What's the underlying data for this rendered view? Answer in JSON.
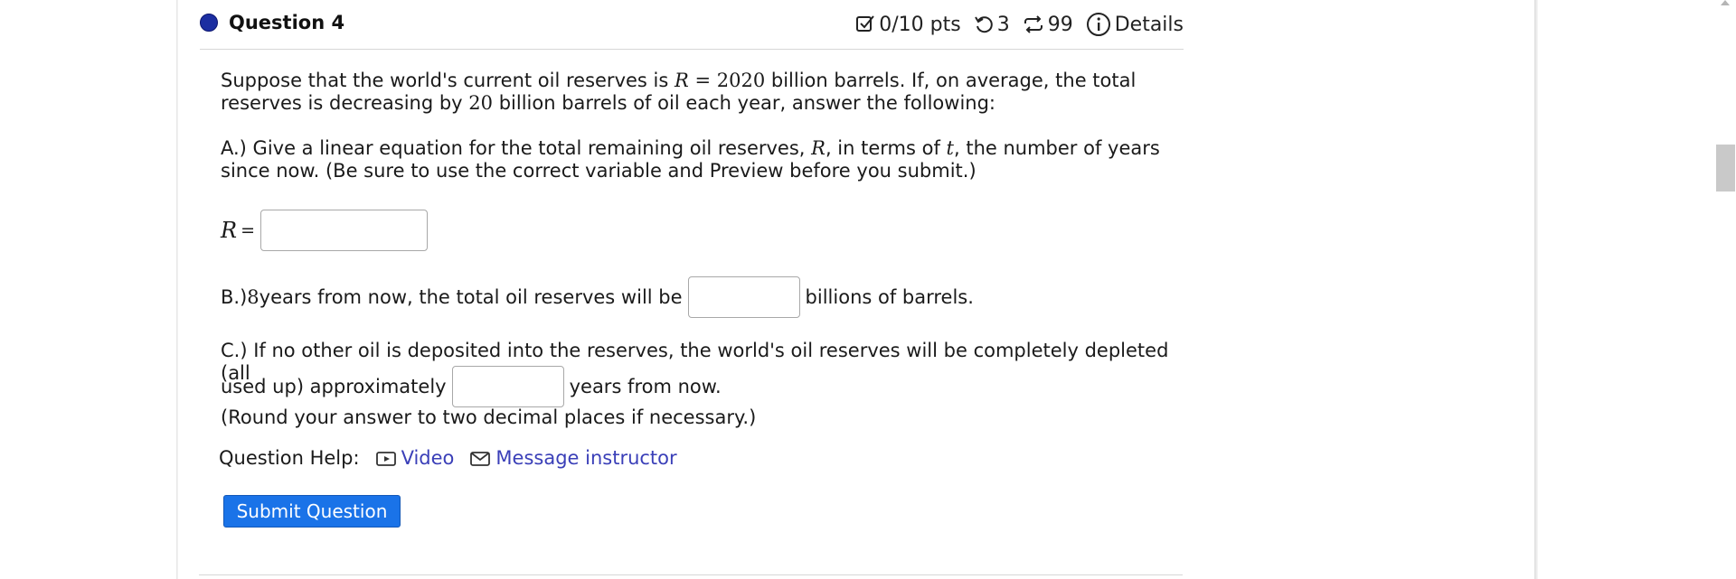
{
  "question": {
    "title": "Question 4",
    "meta": {
      "points": "0/10 pts",
      "attempts": "3",
      "versions": "99",
      "details": "Details"
    }
  },
  "body": {
    "intro_pre": "Suppose that the world's current oil reserves is ",
    "intro_R": "R",
    "intro_eq": " = ",
    "intro_val": "2020",
    "intro_mid": " billion barrels. If, on average, the total reserves is decreasing by ",
    "intro_rate": "20",
    "intro_post": " billion barrels of oil each year, answer the following:",
    "a_pre": "A.) Give a linear equation for the total remaining oil reserves, ",
    "a_R": "R",
    "a_mid": ", in terms of ",
    "a_t": "t",
    "a_post": ",  the number of years since now. (Be sure to use the correct variable and Preview before you submit.)",
    "r_label": "R",
    "r_eq": "=",
    "b_pre": "B.) ",
    "b_num": "8",
    "b_mid": " years from now, the total oil reserves will be",
    "b_post": "billions of barrels.",
    "c_line1": "C.) If no other oil is deposited into the reserves, the world's oil reserves will be completely depleted (all",
    "c_line2_pre": "used up) approximately",
    "c_line2_post": "years from now.",
    "c_round": "(Round your answer to two decimal places if necessary.)"
  },
  "help": {
    "label": "Question Help:",
    "video": "Video",
    "message": "Message instructor"
  },
  "submit_label": "Submit Question"
}
